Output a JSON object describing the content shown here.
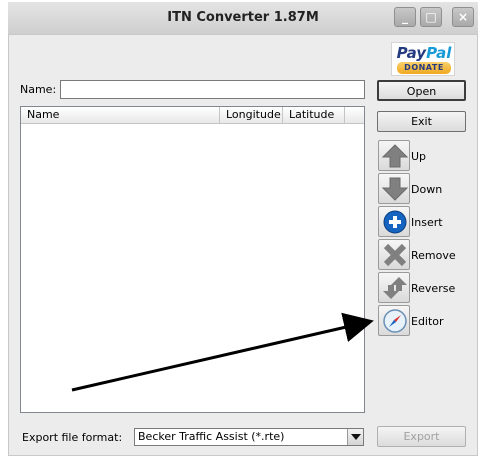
{
  "window": {
    "title": "ITN Converter 1.87M",
    "min_glyph": "_",
    "max_glyph": "□",
    "close_glyph": "×"
  },
  "paypal": {
    "pay": "Pay",
    "pal": "Pal",
    "donate": "DONATE"
  },
  "name": {
    "label": "Name:",
    "value": ""
  },
  "buttons": {
    "open": "Open",
    "exit": "Exit",
    "export": "Export"
  },
  "list": {
    "columns": [
      "Name",
      "Longitude",
      "Latitude"
    ],
    "rows": []
  },
  "side_buttons": {
    "up": {
      "label": "Up",
      "icon": "up-arrow-icon"
    },
    "down": {
      "label": "Down",
      "icon": "down-arrow-icon"
    },
    "insert": {
      "label": "Insert",
      "icon": "plus-circle-icon"
    },
    "remove": {
      "label": "Remove",
      "icon": "x-icon"
    },
    "reverse": {
      "label": "Reverse",
      "icon": "reverse-arrows-icon"
    },
    "editor": {
      "label": "Editor",
      "icon": "compass-icon"
    }
  },
  "export": {
    "label": "Export file format:",
    "selected": "Becker Traffic Assist (*.rte)"
  },
  "colors": {
    "paypal_blue": "#253b80",
    "paypal_light": "#179bd7",
    "insert_blue": "#1565c0",
    "icon_gray": "#808080"
  }
}
